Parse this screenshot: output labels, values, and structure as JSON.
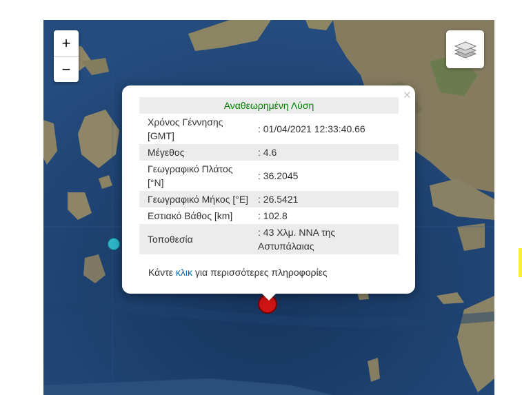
{
  "map": {
    "zoom_in_label": "+",
    "zoom_out_label": "−",
    "layers_icon": "layers-icon"
  },
  "popup": {
    "title": "Αναθεωρημένη Λύση",
    "close_label": "×",
    "rows": [
      {
        "label": "Χρόνος Γέννησης [GMT]",
        "value": ": 01/04/2021 12:33:40.66"
      },
      {
        "label": "Μέγεθος",
        "value": ": 4.6"
      },
      {
        "label": "Γεωγραφικό Πλάτος [°N]",
        "value": ": 36.2045"
      },
      {
        "label": "Γεωγραφικό Μήκος [°E]",
        "value": ": 26.5421"
      },
      {
        "label": "Εστιακό Βάθος [km]",
        "value": ": 102.8"
      },
      {
        "label": "Τοποθεσία",
        "value": ": 43 Χλμ. ΝΝΑ της Αστυπάλαιας"
      }
    ],
    "more_prefix": "Κάντε ",
    "more_link": "κλικ",
    "more_suffix": " για περισσότερες πληροφορίες"
  },
  "markers": {
    "event_color": "#d01515",
    "other_color": "#2fb4c8"
  },
  "colors": {
    "sea": "#1a3a66",
    "land": "#8a8266",
    "title_green": "#008000",
    "link_blue": "#0a6aa7"
  }
}
